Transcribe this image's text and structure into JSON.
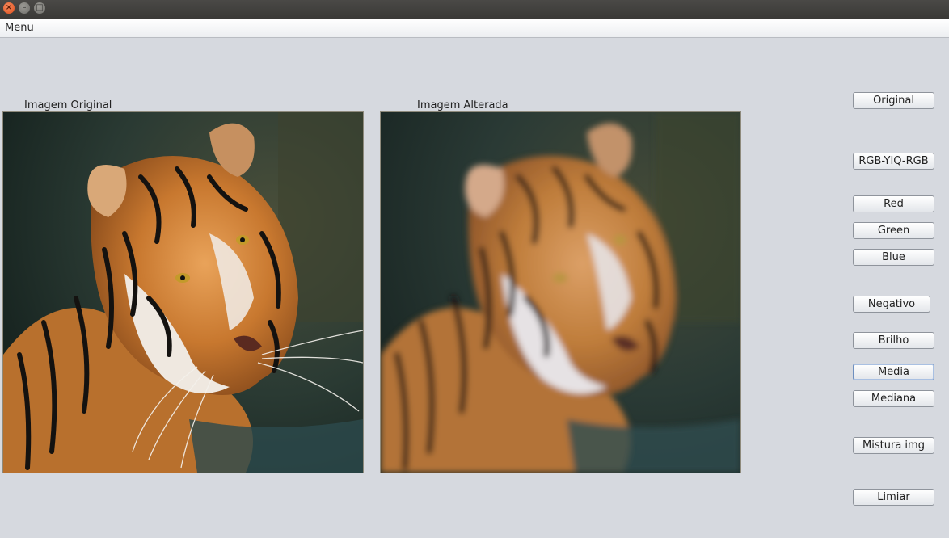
{
  "window": {
    "close_glyph": "×",
    "minimize_glyph": "–",
    "maximize_glyph": "□"
  },
  "menubar": {
    "menu_label": "Menu"
  },
  "panels": {
    "original_label": "Imagem Original",
    "altered_label": "Imagem Alterada"
  },
  "buttons": {
    "original": "Original",
    "rgb_yiq_rgb": "RGB-YIQ-RGB",
    "red": "Red",
    "green": "Green",
    "blue": "Blue",
    "negativo": "Negativo",
    "brilho": "Brilho",
    "media": "Media",
    "mediana": "Mediana",
    "mistura_img": "Mistura img",
    "limiar": "Limiar"
  },
  "colors": {
    "window_bg": "#d6d9df",
    "titlebar": "#3f3e3b",
    "close_button": "#e9602b",
    "focus_border": "#6e8fbf"
  }
}
